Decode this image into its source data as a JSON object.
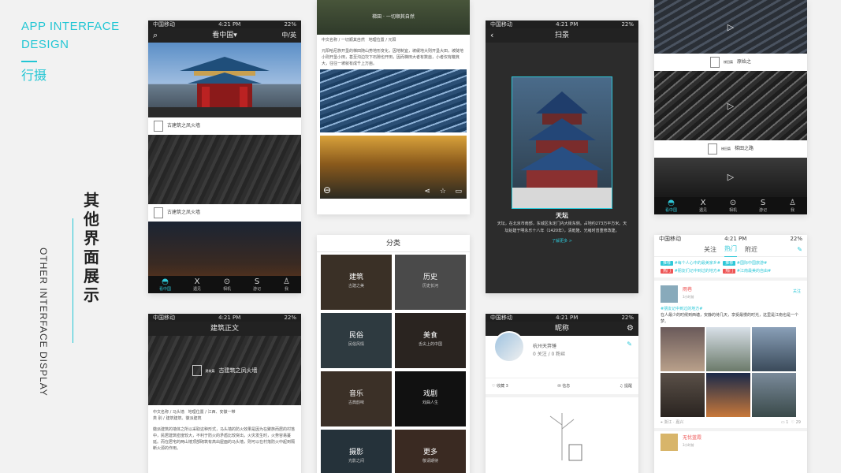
{
  "brand": {
    "title_en": "APP INTERFACE DESIGN",
    "title_cn": "行摄"
  },
  "section": {
    "title_cn": "其他界面展示",
    "title_en": "OTHER INTERFACE DISPLAY"
  },
  "status": {
    "carrier": "中国移动",
    "time": "4:21 PM",
    "battery": "22%"
  },
  "home": {
    "nav_title": "看中国▾",
    "lang": "中/英",
    "caption1": "古建筑之凤火墙",
    "caption2": "古建筑之凤火墙",
    "tag": "建筑篇"
  },
  "tabs": [
    {
      "icon": "◓",
      "label": "看中国"
    },
    {
      "icon": "X",
      "label": "遇见"
    },
    {
      "icon": "⊙",
      "label": "相机"
    },
    {
      "icon": "S",
      "label": "游记"
    },
    {
      "icon": "♙",
      "label": "我"
    }
  ],
  "article": {
    "title": "建筑正文",
    "stamp_label": "建筑篇",
    "caption": "古建筑之凤火墙",
    "meta1": "中文名称 / 马头墙",
    "meta2": "地理位置 / 江西、安徽一带",
    "meta3": "类 别 / 建筑建筑、徽派建筑",
    "body": "徽派建筑的墙体之所以采取这种形式，马头墙的防火效果是因为在聚族而居的村落中，民居建筑密度较大，不利于防火的矛盾比较突出，火灾发生时，火势容易蔓延。而在居宅的两山墙顶部砌筑有高出屋面的马头墙，则可以在村落防火中起到隔断火源的作用。"
  },
  "terrace": {
    "top_caption": "梯田 · 一切顺其自然",
    "meta1": "中文名称 / 一切顺其自然",
    "meta2": "地理位置 / 元阳",
    "body": "元阳哈尼族开垦的梯田随山势地形变化，因地制宜，坡缓地大则开垦大田，坡陡地小则开垦小田，甚至沟边坎下石隙也开田，因而梯田大者有数亩，小者仅有簸箕大，往往一坡就有成千上万亩。"
  },
  "category": {
    "title": "分类",
    "items": [
      {
        "name": "建筑",
        "sub": "古建之美",
        "color": "#3a3026"
      },
      {
        "name": "历史",
        "sub": "历史长河",
        "color": "#4a4a4a"
      },
      {
        "name": "民俗",
        "sub": "民俗风情",
        "color": "#2e3a40"
      },
      {
        "name": "美食",
        "sub": "舌尖上的中国",
        "color": "#2a2420"
      },
      {
        "name": "音乐",
        "sub": "古典韵味",
        "color": "#3b3027"
      },
      {
        "name": "戏剧",
        "sub": "戏曲人生",
        "color": "#111111"
      },
      {
        "name": "摄影",
        "sub": "光影之间",
        "color": "#25323a"
      },
      {
        "name": "更多",
        "sub": "敬请期待",
        "color": "#3a2a22"
      }
    ]
  },
  "scan": {
    "title": "扫景",
    "name": "天坛",
    "desc": "天坛，在北京市南部，东城区永定门内大街东侧。占地约273万平方米。天坛始建于明永乐十八年（1420年），清乾隆、光绪时曾重修改建。",
    "more": "了解更多 >"
  },
  "profile": {
    "title": "昵称",
    "name": "杭州天笄锤",
    "stats": "0 关注 / 0 粉丝",
    "fav": "收藏 3",
    "msg": "信息",
    "remind": "提醒"
  },
  "video": {
    "cap1": "原始之",
    "cap2": "梯田之路",
    "cap1_tag": "梯田篇",
    "cap2_tag": "梯田篇"
  },
  "feed": {
    "tabs": [
      "关注",
      "热门",
      "附近"
    ],
    "tags": [
      "#每个人心中的最美家乡#",
      "#国际中国旅游#",
      "#朋友们记中到过的地方#",
      "#江南最美的自由#"
    ],
    "chip1": "推荐",
    "chip2": "热门",
    "chip3": "推荐",
    "chip4": "热门",
    "user1": "雨巷",
    "time1": "3小时前",
    "post": "#朋友记中到过的地方#",
    "post_body": "在人最少的时候到西塘，安静的待几天，享受最慢的时光，这里是江南也是一个梦。",
    "location": "浙江 · 嘉兴",
    "likes": "29",
    "comments": "1",
    "user2": "无忧蓝霞",
    "time2": "3小时前",
    "follow": "关注"
  }
}
